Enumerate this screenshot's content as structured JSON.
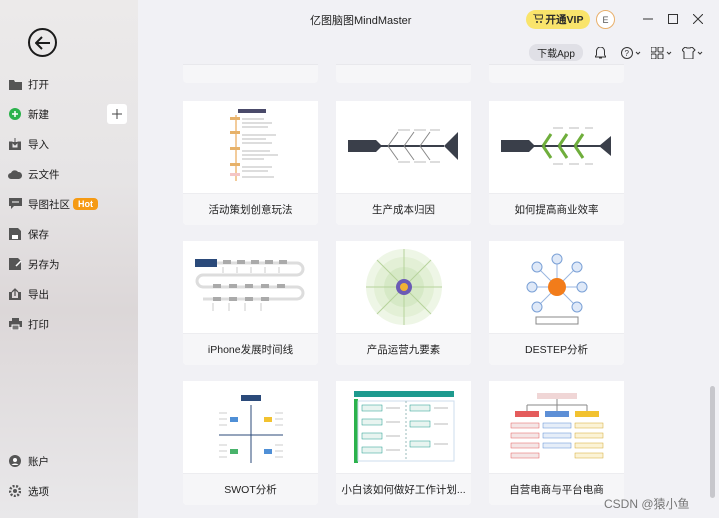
{
  "app": {
    "title": "亿图脑图MindMaster"
  },
  "header": {
    "vip_label": "开通VIP",
    "avatar_letter": "E",
    "download_label": "下载App"
  },
  "sidebar": {
    "items": [
      {
        "label": "打开",
        "icon": "folder-icon"
      },
      {
        "label": "新建",
        "icon": "add-circle-icon"
      },
      {
        "label": "导入",
        "icon": "import-icon"
      },
      {
        "label": "云文件",
        "icon": "cloud-icon"
      },
      {
        "label": "导图社区",
        "icon": "community-icon",
        "badge": "Hot"
      },
      {
        "label": "保存",
        "icon": "save-icon"
      },
      {
        "label": "另存为",
        "icon": "save-as-icon"
      },
      {
        "label": "导出",
        "icon": "export-icon"
      },
      {
        "label": "打印",
        "icon": "print-icon"
      },
      {
        "label": "账户",
        "icon": "account-icon"
      },
      {
        "label": "选项",
        "icon": "settings-icon"
      }
    ]
  },
  "templates": [
    {
      "caption": "活动策划创意玩法"
    },
    {
      "caption": "生产成本归因"
    },
    {
      "caption": "如何提高商业效率"
    },
    {
      "caption": "iPhone发展时间线"
    },
    {
      "caption": "产品运营九要素"
    },
    {
      "caption": "DESTEP分析"
    },
    {
      "caption": "SWOT分析"
    },
    {
      "caption": "小白该如何做好工作计划..."
    },
    {
      "caption": "自营电商与平台电商"
    }
  ],
  "watermark": "CSDN @猿小鱼",
  "colors": {
    "accent_green": "#2bb24c",
    "vip_yellow": "#f9e46b",
    "hot_orange": "#f59a13"
  }
}
